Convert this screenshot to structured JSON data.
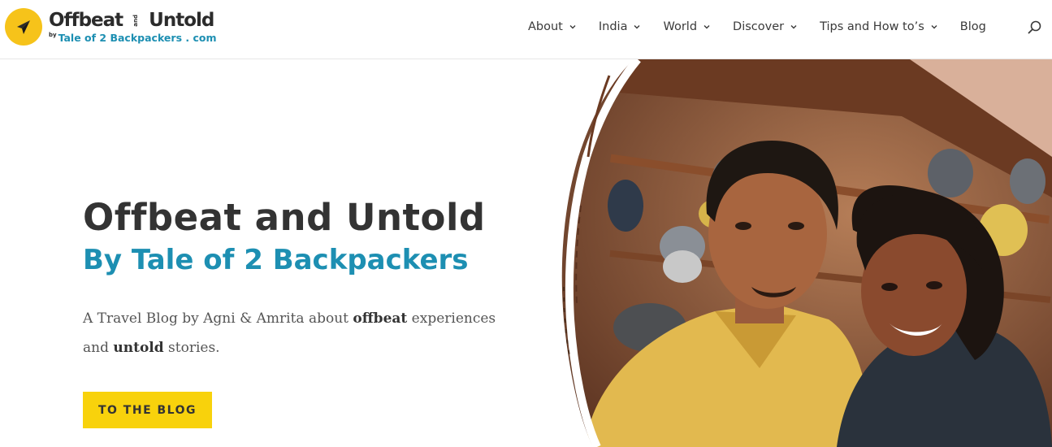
{
  "logo": {
    "main_left": "Offbeat",
    "main_and": "and",
    "main_right": "Untold",
    "sub_by": "by",
    "sub_text": "Tale of 2 Backpackers . com",
    "icon": "paper-plane-icon"
  },
  "nav": {
    "items": [
      {
        "label": "About",
        "has_dropdown": true
      },
      {
        "label": "India",
        "has_dropdown": true
      },
      {
        "label": "World",
        "has_dropdown": true
      },
      {
        "label": "Discover",
        "has_dropdown": true
      },
      {
        "label": "Tips and How to’s",
        "has_dropdown": true
      },
      {
        "label": "Blog",
        "has_dropdown": false
      }
    ],
    "search_icon": "search-icon"
  },
  "hero": {
    "title": "Offbeat and Untold",
    "subtitle": "By Tale of 2 Backpackers",
    "desc_part1": "A Travel Blog by Agni & Amrita about ",
    "desc_bold1": "offbeat",
    "desc_part2": " experiences and ",
    "desc_bold2": "untold",
    "desc_part3": " stories.",
    "cta_label": "TO THE BLOG"
  },
  "colors": {
    "accent_blue": "#1d8fb2",
    "accent_yellow": "#f8d20c",
    "logo_yellow": "#f6c31a",
    "text_dark": "#333333"
  }
}
